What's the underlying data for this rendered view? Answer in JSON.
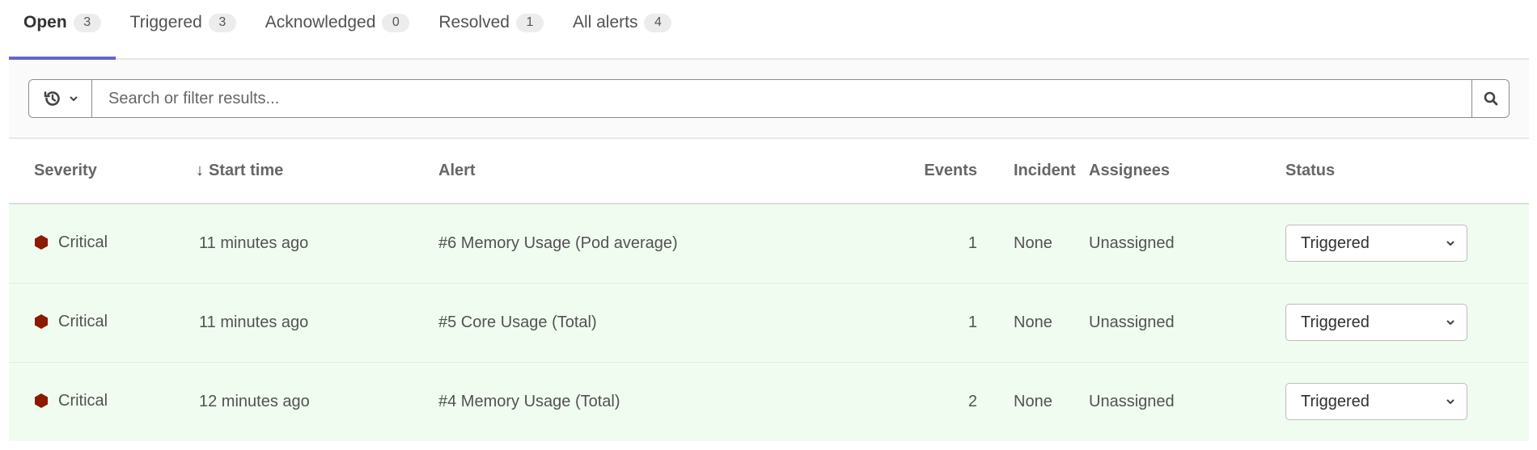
{
  "tabs": [
    {
      "label": "Open",
      "count": "3",
      "active": true
    },
    {
      "label": "Triggered",
      "count": "3",
      "active": false
    },
    {
      "label": "Acknowledged",
      "count": "0",
      "active": false
    },
    {
      "label": "Resolved",
      "count": "1",
      "active": false
    },
    {
      "label": "All alerts",
      "count": "4",
      "active": false
    }
  ],
  "filter": {
    "placeholder": "Search or filter results...",
    "value": "",
    "history_icon": "history-icon",
    "search_icon": "search-icon"
  },
  "table": {
    "columns": {
      "severity": "Severity",
      "start_time": "Start time",
      "start_time_sort": "↓",
      "alert": "Alert",
      "events": "Events",
      "incident": "Incident",
      "assignees": "Assignees",
      "status": "Status"
    },
    "rows": [
      {
        "severity": "Critical",
        "start_time": "11 minutes ago",
        "alert": "#6 Memory Usage (Pod average)",
        "events": "1",
        "incident": "None",
        "assignees": "Unassigned",
        "status": "Triggered"
      },
      {
        "severity": "Critical",
        "start_time": "11 minutes ago",
        "alert": "#5 Core Usage (Total)",
        "events": "1",
        "incident": "None",
        "assignees": "Unassigned",
        "status": "Triggered"
      },
      {
        "severity": "Critical",
        "start_time": "12 minutes ago",
        "alert": "#4 Memory Usage (Total)",
        "events": "2",
        "incident": "None",
        "assignees": "Unassigned",
        "status": "Triggered"
      }
    ]
  },
  "colors": {
    "active_tab_underline": "#6666c4",
    "critical": "#8b1a00",
    "row_background": "#f1fcf1"
  }
}
